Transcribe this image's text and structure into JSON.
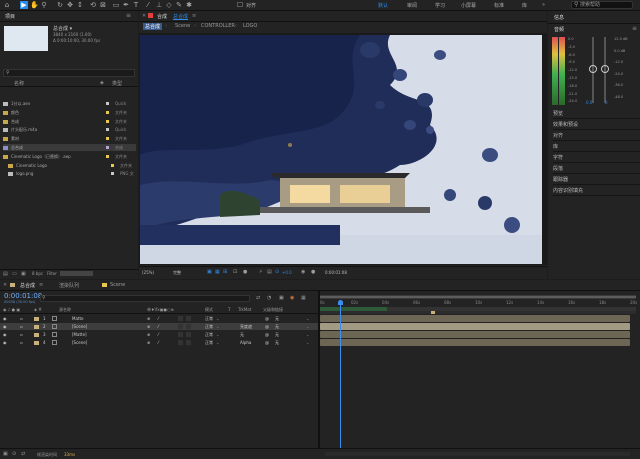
{
  "toolbar": {
    "align_label": "对齐",
    "workspaces": [
      "默认",
      "审阅",
      "学习",
      "小屏幕",
      "标准",
      "库"
    ],
    "search_placeholder": "搜索帮助"
  },
  "project": {
    "tab": "项目",
    "comp_name": "总合成 ▾",
    "comp_info": [
      "3840 x 2160 (1.00)",
      "Δ 0:00:10:00, 30.00 fps"
    ],
    "search_icon": "search-icon",
    "col_name": "名称",
    "col_type": "类型",
    "rows": [
      {
        "name": "1分以.aev",
        "type": "Quick",
        "color": "#c8c8c8"
      },
      {
        "name": "颜色",
        "type": "文件夹",
        "color": "#e8c94a"
      },
      {
        "name": "合成",
        "type": "文件夹",
        "color": "#e8c94a"
      },
      {
        "name": "片头配乐.m4a",
        "type": "Quick",
        "color": "#c8c8c8"
      },
      {
        "name": "素材",
        "type": "文件夹",
        "color": "#e8c94a"
      },
      {
        "name": "总合成",
        "type": "合成",
        "color": "#b9a4d8"
      },
      {
        "name": "Cinematic Logo（已替换）.aep",
        "type": "文件夹",
        "color": "#e8c94a"
      },
      {
        "name": "Cinematic Logo",
        "type": "文件夹",
        "color": "#e8c94a"
      },
      {
        "name": "logo.png",
        "type": "PNG 文",
        "color": "#c8c8c8"
      }
    ],
    "bit_depth": "8 bpc",
    "filter_label": "Filter"
  },
  "viewer": {
    "tab_prefix": "合成",
    "tab_name": "总合成",
    "crumbs": [
      "总合成",
      "Scene",
      "CONTROLLER",
      "LOGO"
    ],
    "zoom": "(25%)",
    "quality": "完整",
    "exposure": "+0.0",
    "timecode": "0:00:01:08"
  },
  "right_panel": {
    "info_tab": "信息",
    "audio_tab": "音频",
    "db_left": [
      "0.0",
      "-3.0",
      "-6.0",
      "-9.0",
      "-12.0",
      "-15.0",
      "-18.0",
      "-21.0",
      "-24.0"
    ],
    "db_right": [
      "12.0 dB",
      "0.0 dB",
      "-12.0",
      "-24.0",
      "-36.0",
      "-48.0"
    ],
    "vals": [
      "0.0",
      "0"
    ],
    "items": [
      "预览",
      "效果和预设",
      "对齐",
      "库",
      "字符",
      "段落",
      "跟踪器",
      "内容识别填充"
    ]
  },
  "timeline": {
    "tabs": [
      "总合成",
      "渲染队列",
      "Scene"
    ],
    "timecode": "0:00:01:08",
    "frame_info": "00038 (30.00 fps)",
    "headers": [
      "源名称",
      "单♦\\fx▣●○⊕",
      "模式",
      "T",
      "TrkMat",
      "父级和链接"
    ],
    "ruler": [
      "0s",
      "02s",
      "04s",
      "06s",
      "08s",
      "10s",
      "12s",
      "14s",
      "16s",
      "18s",
      "20s"
    ],
    "layers": [
      {
        "num": "1",
        "name": "Matte",
        "mode": "正常",
        "trk": "",
        "parent": "无"
      },
      {
        "num": "2",
        "name": "[Scene]",
        "mode": "正常",
        "trk": "亮度遮",
        "parent": "无"
      },
      {
        "num": "3",
        "name": "[Matte]",
        "mode": "正常",
        "trk": "无",
        "parent": "无"
      },
      {
        "num": "4",
        "name": "[Scene]",
        "mode": "正常",
        "trk": "Alpha",
        "parent": "无"
      }
    ],
    "footer_label": "帧渲染时间",
    "footer_value": "33ms"
  },
  "colors": {
    "accent": "#2d8ceb",
    "timecode": "#6fb0ff",
    "label_tan": "#c9b27a"
  }
}
